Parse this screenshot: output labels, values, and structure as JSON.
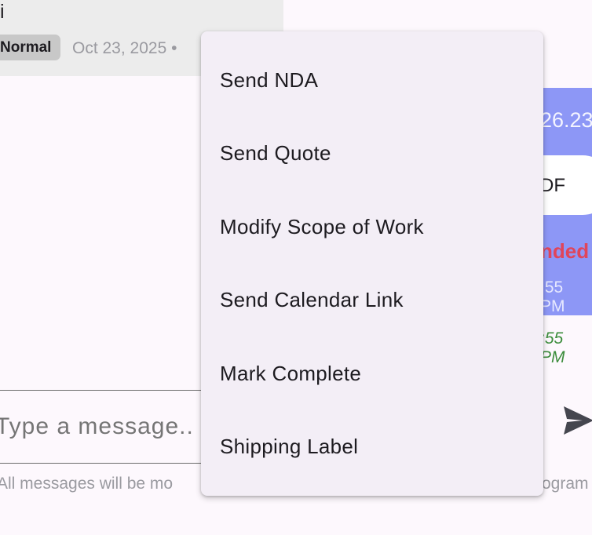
{
  "message": {
    "text_fragment": "i",
    "priority_badge": "Normal",
    "date": "Oct 23, 2025 •"
  },
  "outgoing": {
    "amount_fragment": "26.23",
    "pill_fragment": "DF",
    "status_fragment": "nded",
    "time_fragment": ":55 PM",
    "time2_fragment": ":55 PM"
  },
  "composer": {
    "placeholder": "Type a message..",
    "note_left": "All messages will be mo",
    "note_right": "ogram"
  },
  "menu": {
    "items": [
      {
        "label": "Send NDA"
      },
      {
        "label": "Send Quote"
      },
      {
        "label": "Modify Scope of Work"
      },
      {
        "label": "Send Calendar Link"
      },
      {
        "label": "Mark Complete"
      },
      {
        "label": "Shipping Label"
      }
    ]
  },
  "icons": {
    "send": "send-icon"
  },
  "colors": {
    "background": "#fdf8fd",
    "menu_bg": "#f3eef6",
    "outgoing_bubble": "#8d97f6",
    "status_red": "#e0455a"
  }
}
